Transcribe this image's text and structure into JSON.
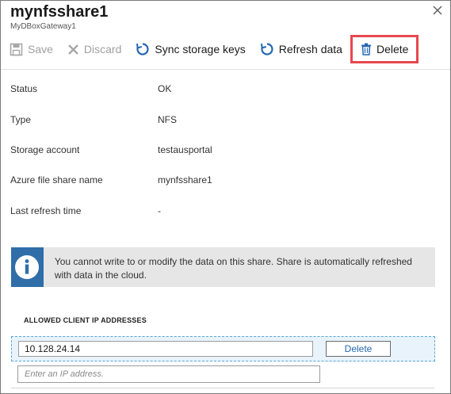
{
  "header": {
    "title": "mynfsshare1",
    "subtitle": "MyDBoxGateway1"
  },
  "toolbar": {
    "save_label": "Save",
    "discard_label": "Discard",
    "sync_label": "Sync storage keys",
    "refresh_label": "Refresh data",
    "delete_label": "Delete"
  },
  "properties": [
    {
      "key": "Status",
      "value": "OK"
    },
    {
      "key": "Type",
      "value": "NFS"
    },
    {
      "key": "Storage account",
      "value": "testausportal"
    },
    {
      "key": "Azure file share name",
      "value": "mynfsshare1"
    },
    {
      "key": "Last refresh time",
      "value": "-"
    }
  ],
  "info": {
    "message": "You cannot write to or modify the data on this share. Share is automatically refreshed with data in the cloud."
  },
  "allowed_ips": {
    "section_title": "ALLOWED CLIENT IP ADDRESSES",
    "entries": [
      {
        "ip": "10.128.24.14",
        "delete_label": "Delete"
      }
    ],
    "new_placeholder": "Enter an IP address."
  },
  "colors": {
    "accent": "#2467b1",
    "highlight_border": "#e7474e",
    "info_icon_bg": "#2f6ea8"
  }
}
